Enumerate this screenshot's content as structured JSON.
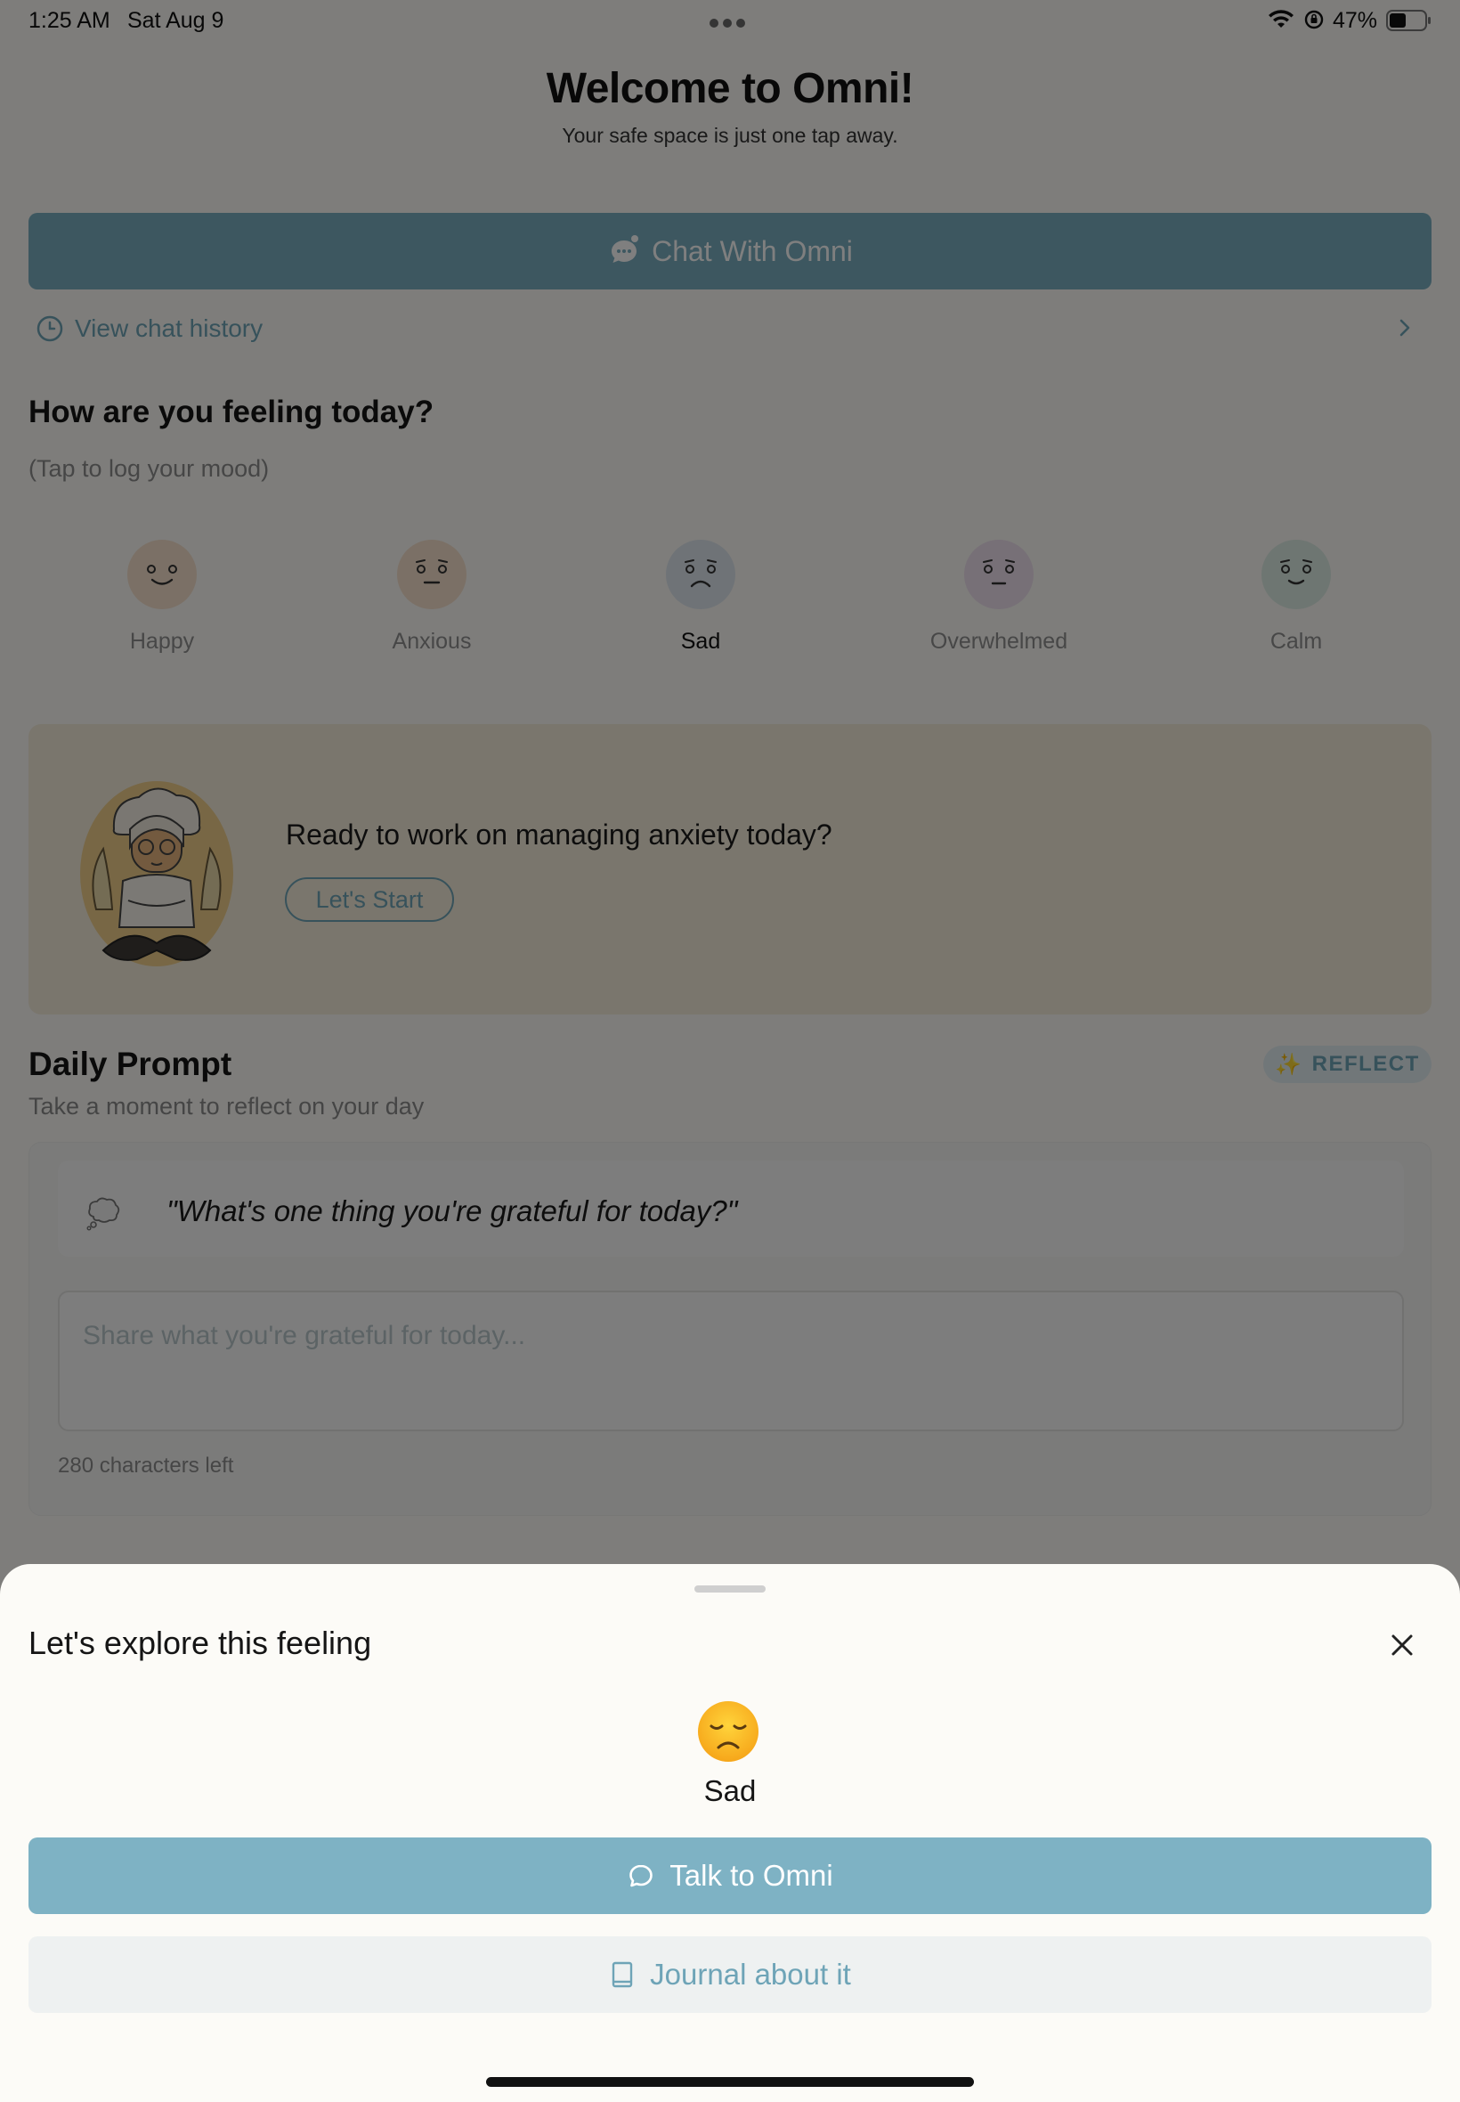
{
  "status_bar": {
    "time": "1:25 AM",
    "date": "Sat Aug 9",
    "battery_percent": "47%",
    "battery_level": 0.47,
    "icons": [
      "more-dots-icon",
      "wifi-icon",
      "orientation-lock-icon",
      "battery-icon"
    ]
  },
  "header": {
    "title": "Welcome to Omni!",
    "subtitle": "Your safe space is just one tap away."
  },
  "chat": {
    "button_label": "Chat With Omni",
    "history_label": "View chat history"
  },
  "mood": {
    "title": "How are you feeling today?",
    "hint": "(Tap to log your mood)",
    "selected": "Sad",
    "options": [
      {
        "label": "Happy",
        "color": "#f6e1cc"
      },
      {
        "label": "Anxious",
        "color": "#f6e1cc"
      },
      {
        "label": "Sad",
        "color": "#dfe6ee"
      },
      {
        "label": "Overwhelmed",
        "color": "#eee0ee"
      },
      {
        "label": "Calm",
        "color": "#dcece4"
      }
    ]
  },
  "promo": {
    "text": "Ready to work on managing anxiety today?",
    "button_label": "Let's Start"
  },
  "daily_prompt": {
    "title": "Daily Prompt",
    "subtitle": "Take a moment to reflect on your day",
    "badge": "REFLECT",
    "badge_icon": "✨",
    "question": "\"What's one thing you're grateful for today?\"",
    "input_value": "",
    "input_placeholder": "Share what you're grateful for today...",
    "chars_left": "280 characters left"
  },
  "sheet": {
    "title": "Let's explore this feeling",
    "emoji": "disappointed-face",
    "mood_label": "Sad",
    "talk_label": "Talk to Omni",
    "journal_label": "Journal about it"
  },
  "colors": {
    "accent": "#7aafc1",
    "accent_text": "#6ea4b7",
    "promo_bg": "#f4ecdb",
    "sheet_bg": "#fcfbf7",
    "overlay": "rgba(0,0,0,0.5)"
  }
}
